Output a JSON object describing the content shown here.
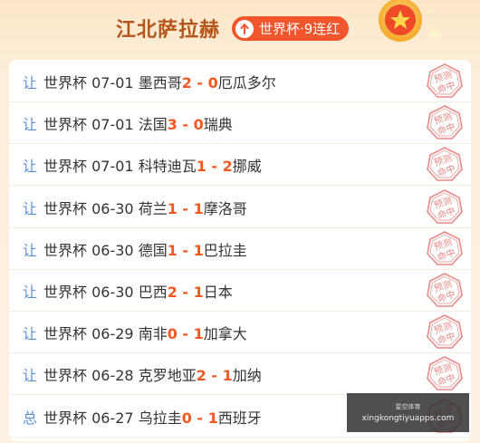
{
  "header": {
    "title": "江北萨拉赫",
    "streak_label": "世界杯·9连红"
  },
  "colors": {
    "title": "#b4561a",
    "streak_bg": "#f0552b",
    "score": "#f05a22",
    "kind": "#5b8ed6",
    "stamp": "#e88a86"
  },
  "stamp_text": [
    "预测",
    "命中"
  ],
  "rows": [
    {
      "kind": "让",
      "league": "世界杯",
      "date": "07-01",
      "home": "墨西哥",
      "home_score": "2",
      "sep": " - ",
      "away_score": "0",
      "away": "厄瓜多尔"
    },
    {
      "kind": "让",
      "league": "世界杯",
      "date": "07-01",
      "home": "法国",
      "home_score": "3",
      "sep": " - ",
      "away_score": "0",
      "away": "瑞典"
    },
    {
      "kind": "让",
      "league": "世界杯",
      "date": "07-01",
      "home": "科特迪瓦",
      "home_score": "1",
      "sep": " - ",
      "away_score": "2",
      "away": "挪威"
    },
    {
      "kind": "让",
      "league": "世界杯",
      "date": "06-30",
      "home": "荷兰",
      "home_score": "1",
      "sep": " - ",
      "away_score": "1",
      "away": "摩洛哥"
    },
    {
      "kind": "让",
      "league": "世界杯",
      "date": "06-30",
      "home": "德国",
      "home_score": "1",
      "sep": " - ",
      "away_score": "1",
      "away": "巴拉圭"
    },
    {
      "kind": "让",
      "league": "世界杯",
      "date": "06-30",
      "home": "巴西",
      "home_score": "2",
      "sep": " - ",
      "away_score": "1",
      "away": "日本"
    },
    {
      "kind": "让",
      "league": "世界杯",
      "date": "06-29",
      "home": "南非",
      "home_score": "0",
      "sep": " - ",
      "away_score": "1",
      "away": "加拿大"
    },
    {
      "kind": "让",
      "league": "世界杯",
      "date": "06-28",
      "home": "克罗地亚",
      "home_score": "2",
      "sep": " - ",
      "away_score": "1",
      "away": "加纳"
    },
    {
      "kind": "总",
      "league": "世界杯",
      "date": "06-27",
      "home": "乌拉圭",
      "home_score": "0",
      "sep": " - ",
      "away_score": "1",
      "away": "西班牙"
    }
  ],
  "watermark": {
    "top": "星空体育",
    "bottom": "xingkongtiyuapps.com"
  }
}
